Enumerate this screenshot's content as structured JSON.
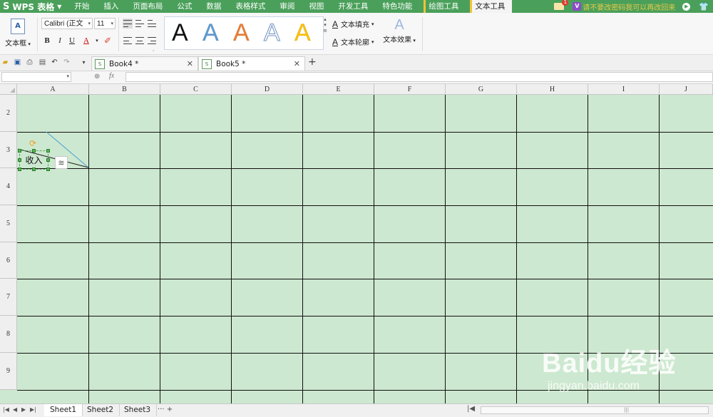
{
  "app": {
    "logo_glyph": "S",
    "name": "WPS 表格"
  },
  "menu": {
    "items": [
      "开始",
      "插入",
      "页面布局",
      "公式",
      "数据",
      "表格样式",
      "审阅",
      "视图",
      "开发工具",
      "特色功能"
    ],
    "context_tabs": [
      "绘图工具",
      "文本工具"
    ],
    "active": "文本工具"
  },
  "top_right": {
    "mail_count": "1",
    "vip_label": "V",
    "promo": "请不要改密码我可以再改回来"
  },
  "ribbon": {
    "textbox_label": "文本框",
    "font_name": "Calibri (正文",
    "font_size": "11",
    "bold": "B",
    "italic": "I",
    "underline": "U",
    "font_color": "A",
    "styles": [
      {
        "glyph": "A",
        "color": "#111111"
      },
      {
        "glyph": "A",
        "color": "#5b9bd5"
      },
      {
        "glyph": "A",
        "color": "#ed7d31"
      },
      {
        "glyph": "A",
        "color": "#ffffff"
      },
      {
        "glyph": "A",
        "color": "#ffc000"
      }
    ],
    "text_fill": "文本填充",
    "text_outline": "文本轮廓",
    "text_effect": "文本效果"
  },
  "tabs": [
    {
      "name": "Book4 *"
    },
    {
      "name": "Book5 *"
    }
  ],
  "formula": {
    "fx": "fx",
    "value": ""
  },
  "grid": {
    "columns": [
      "A",
      "B",
      "C",
      "D",
      "E",
      "F",
      "G",
      "H",
      "I",
      "J"
    ],
    "rows": [
      "2",
      "3",
      "4",
      "5",
      "6",
      "7",
      "8",
      "9"
    ],
    "cell_bg": "#cde8d0"
  },
  "textbox": {
    "text": "收入"
  },
  "sheets": [
    "Sheet1",
    "Sheet2",
    "Sheet3"
  ],
  "watermark": {
    "brand": "Baidu经验",
    "url": "jingyan.baidu.com"
  }
}
